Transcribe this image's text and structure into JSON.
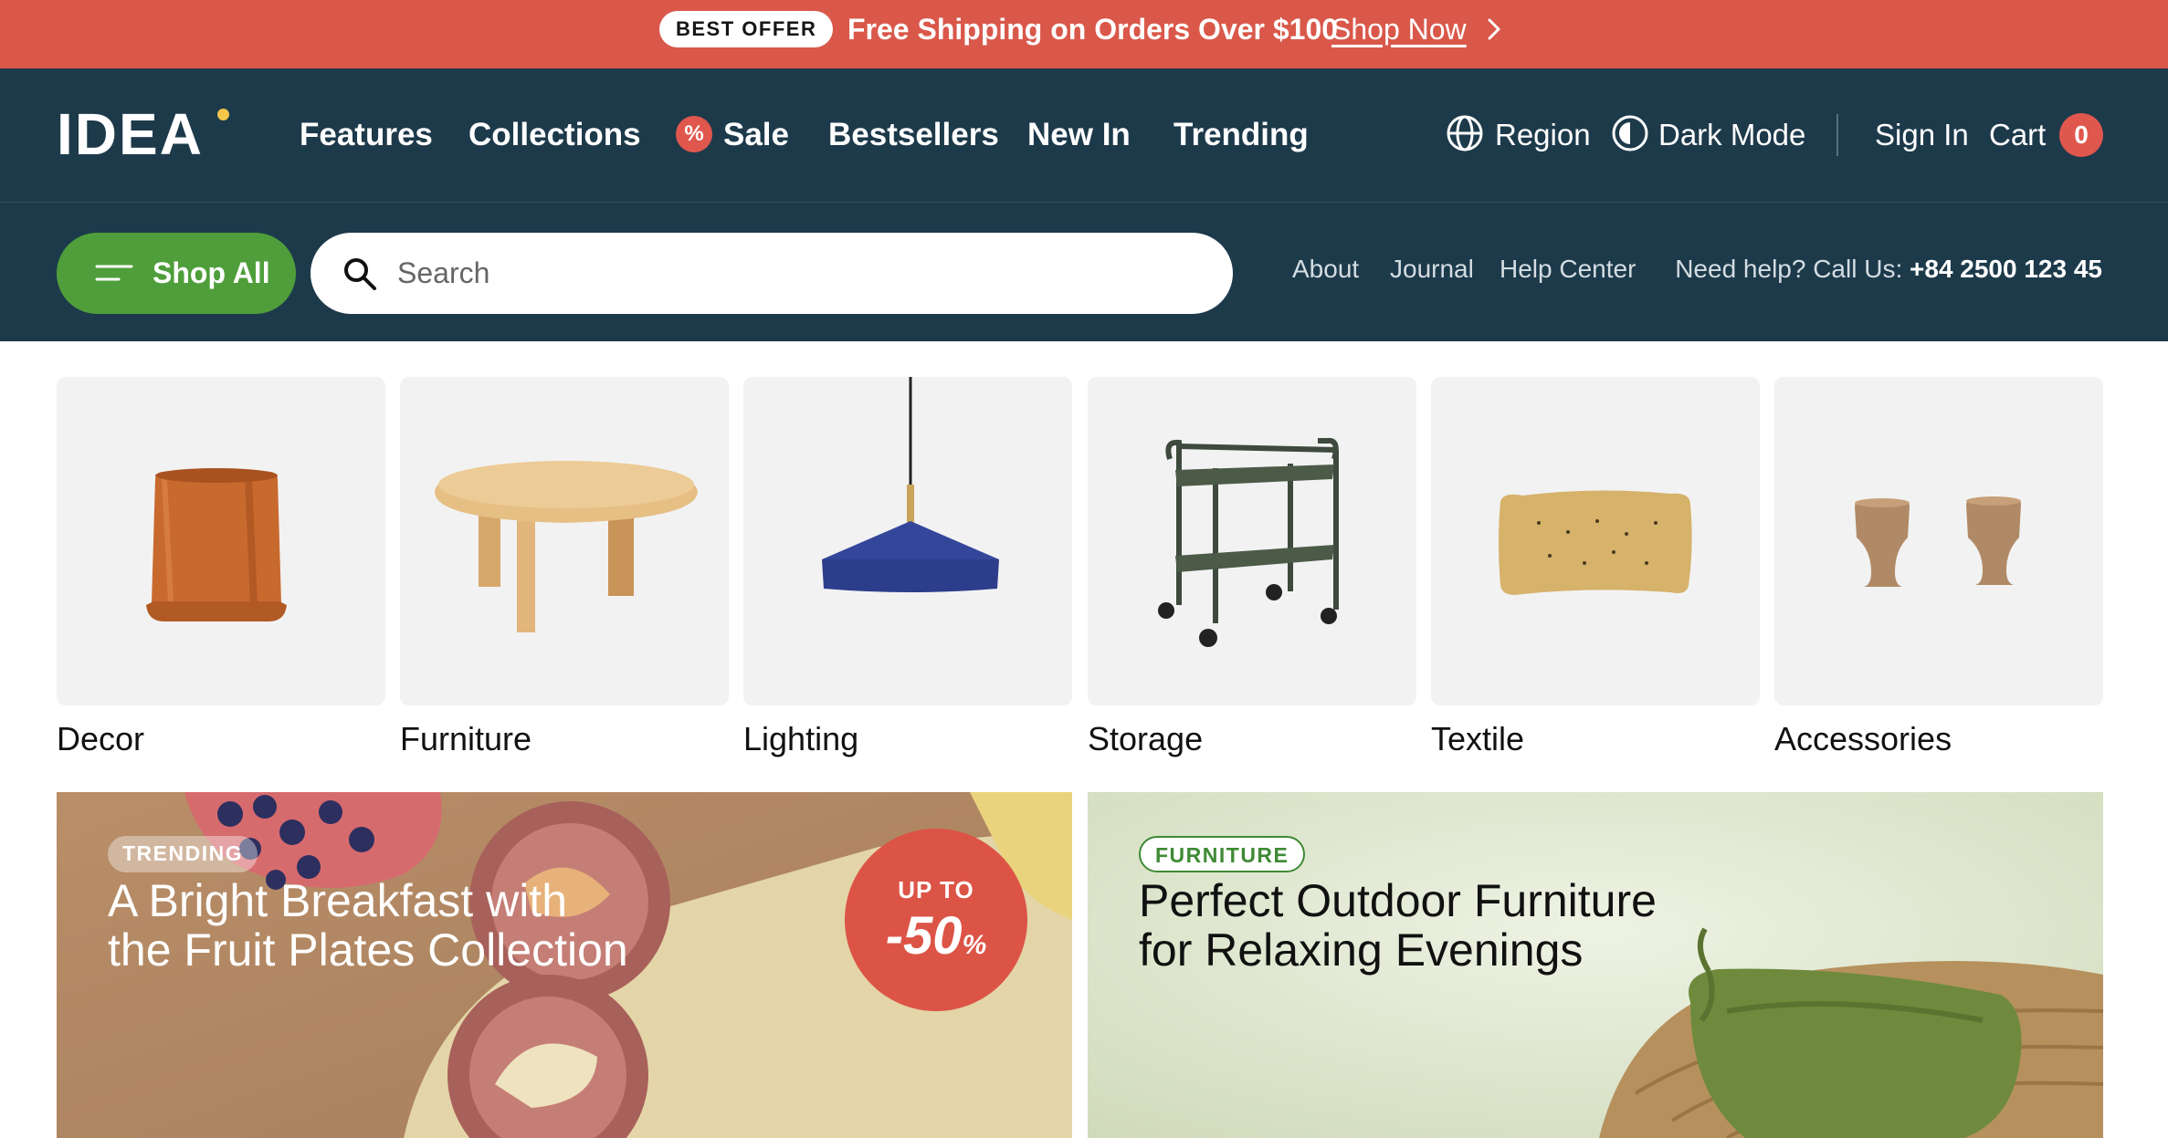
{
  "promo_bar": {
    "badge": "BEST OFFER",
    "text": "Free Shipping on Orders Over $100",
    "link": "Shop Now",
    "chevron_icon": "chevron-right-icon",
    "background": "#d9584a"
  },
  "header": {
    "logo": "IDEA",
    "nav": [
      {
        "label": "Features"
      },
      {
        "label": "Collections"
      },
      {
        "label": "Sale",
        "icon": "percent-icon"
      },
      {
        "label": "Bestsellers"
      },
      {
        "label": "New In"
      },
      {
        "label": "Trending"
      }
    ],
    "region": {
      "label": "Region",
      "icon": "globe-icon"
    },
    "dark_mode": {
      "label": "Dark Mode",
      "icon": "contrast-icon"
    },
    "sign_in": "Sign In",
    "cart": {
      "label": "Cart",
      "count": "0"
    },
    "background": "#1d3a4b"
  },
  "subbar": {
    "shop_all": "Shop All",
    "search_placeholder": "Search",
    "links": [
      "About",
      "Journal",
      "Help Center"
    ],
    "help_prefix": "Need help? Call Us:",
    "help_phone": "+84 2500 123 45"
  },
  "categories": [
    {
      "label": "Decor",
      "image": "planter"
    },
    {
      "label": "Furniture",
      "image": "round-table"
    },
    {
      "label": "Lighting",
      "image": "pendant-lamp"
    },
    {
      "label": "Storage",
      "image": "trolley"
    },
    {
      "label": "Textile",
      "image": "cushion"
    },
    {
      "label": "Accessories",
      "image": "wooden-stools"
    }
  ],
  "cards": [
    {
      "tag": "TRENDING",
      "title_line1": "A Bright Breakfast with",
      "title_line2": "the Fruit Plates Collection",
      "discount_top": "UP TO",
      "discount_value": "-50",
      "discount_suffix": "%"
    },
    {
      "tag": "FURNITURE",
      "title_line1": "Perfect Outdoor Furniture",
      "title_line2": "for Relaxing Evenings"
    }
  ],
  "colors": {
    "accent_red": "#dc5446",
    "shop_all_green": "#4f9e3b",
    "furniture_tag_green": "#3f8a35"
  }
}
